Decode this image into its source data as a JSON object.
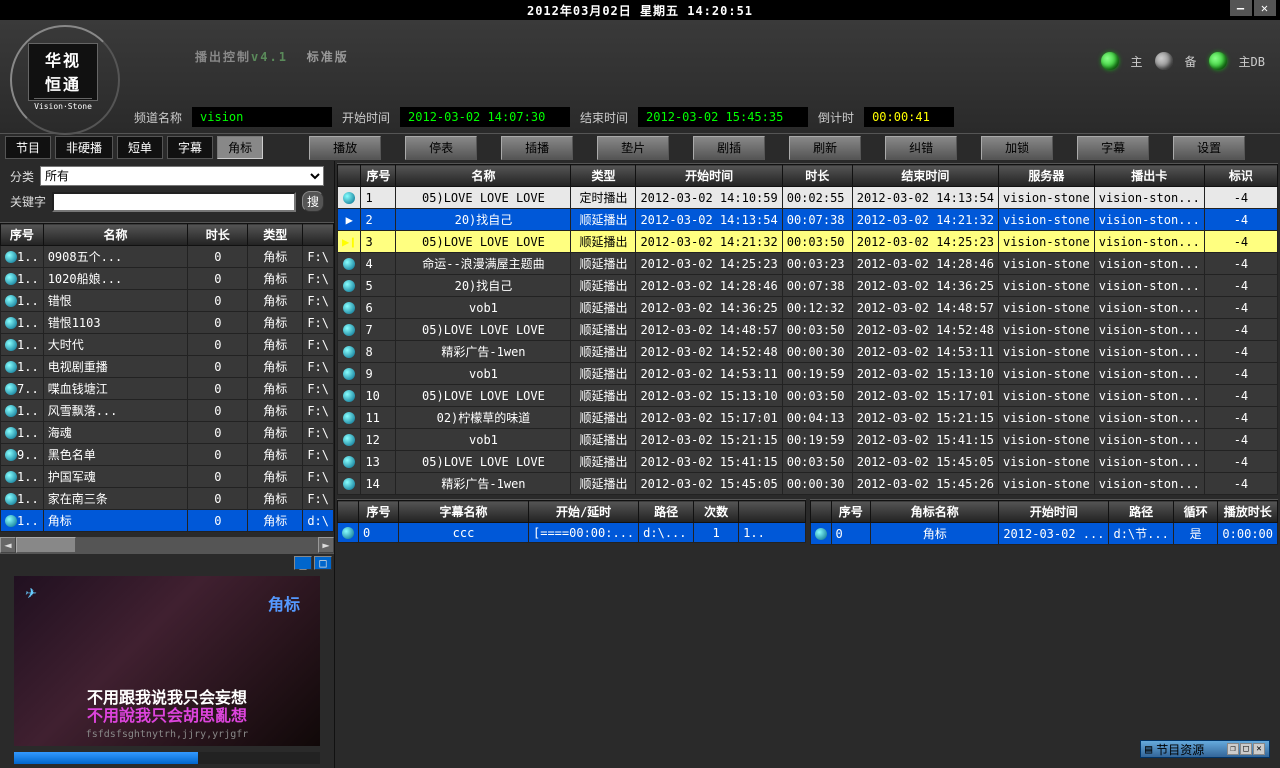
{
  "top": {
    "datetime": "2012年03月02日  星期五    14:20:51"
  },
  "logo": {
    "cn": "华视\n恒通",
    "en": "Vision·Stone"
  },
  "title": {
    "main": "播出控制",
    "ver": "v4.1",
    "std": "标准版"
  },
  "leds": {
    "l1": "主",
    "l2": "备",
    "l3": "主DB"
  },
  "info": {
    "ch_lbl": "频道名称",
    "ch_val": "vision",
    "st_lbl": "开始时间",
    "st_val": "2012-03-02 14:07:30",
    "et_lbl": "结束时间",
    "et_val": "2012-03-02 15:45:35",
    "cd_lbl": "倒计时",
    "cd_val": "00:00:41"
  },
  "tabs": {
    "t1": "节目",
    "t2": "非硬播",
    "t3": "短单",
    "t4": "字幕",
    "t5": "角标"
  },
  "btns": {
    "b1": "播放",
    "b2": "停表",
    "b3": "插播",
    "b4": "垫片",
    "b5": "剧插",
    "b6": "刷新",
    "b7": "纠错",
    "b8": "加锁",
    "b9": "字幕",
    "b10": "设置"
  },
  "filter": {
    "cat_lbl": "分类",
    "cat_val": "所有",
    "kw_lbl": "关键字",
    "srch": "搜"
  },
  "side_cols": {
    "c1": "序号",
    "c2": "名称",
    "c3": "时长",
    "c4": "类型",
    "c5": ""
  },
  "side_rows": [
    {
      "n": "1..",
      "name": "0908五个...",
      "dur": "0",
      "type": "角标",
      "p": "F:\\"
    },
    {
      "n": "1..",
      "name": "1020船娘...",
      "dur": "0",
      "type": "角标",
      "p": "F:\\"
    },
    {
      "n": "1..",
      "name": "错恨",
      "dur": "0",
      "type": "角标",
      "p": "F:\\"
    },
    {
      "n": "1..",
      "name": "错恨1103",
      "dur": "0",
      "type": "角标",
      "p": "F:\\"
    },
    {
      "n": "1..",
      "name": "大时代",
      "dur": "0",
      "type": "角标",
      "p": "F:\\"
    },
    {
      "n": "1..",
      "name": "电视剧重播",
      "dur": "0",
      "type": "角标",
      "p": "F:\\"
    },
    {
      "n": "7..",
      "name": "喋血钱塘江",
      "dur": "0",
      "type": "角标",
      "p": "F:\\"
    },
    {
      "n": "1..",
      "name": "风雪飘落...",
      "dur": "0",
      "type": "角标",
      "p": "F:\\"
    },
    {
      "n": "1..",
      "name": "海魂",
      "dur": "0",
      "type": "角标",
      "p": "F:\\"
    },
    {
      "n": "9..",
      "name": "黑色名单",
      "dur": "0",
      "type": "角标",
      "p": "F:\\"
    },
    {
      "n": "1..",
      "name": "护国军魂",
      "dur": "0",
      "type": "角标",
      "p": "F:\\"
    },
    {
      "n": "1..",
      "name": "家在南三条",
      "dur": "0",
      "type": "角标",
      "p": "F:\\"
    },
    {
      "n": "1..",
      "name": "角标",
      "dur": "0",
      "type": "角标",
      "p": "d:\\",
      "sel": true
    }
  ],
  "preview": {
    "corner": "角标",
    "sub1": "不用跟我说我只会妄想",
    "sub2": "不用說我只会胡思亂想",
    "sub3": "fsfdsfsghtnytrh,jjry,yrjgfr"
  },
  "pl_cols": {
    "c1": "序号",
    "c2": "名称",
    "c3": "类型",
    "c4": "开始时间",
    "c5": "时长",
    "c6": "结束时间",
    "c7": "服务器",
    "c8": "播出卡",
    "c9": "标识"
  },
  "pl_rows": [
    {
      "n": "1",
      "name": "05)LOVE LOVE LOVE",
      "type": "定时播出",
      "st": "2012-03-02 14:10:59",
      "dur": "00:02:55",
      "et": "2012-03-02 14:13:54",
      "srv": "vision-stone",
      "card": "vision-ston...",
      "flag": "-4",
      "kind": "wh"
    },
    {
      "n": "2",
      "name": "20)找自己",
      "type": "顺延播出",
      "st": "2012-03-02 14:13:54",
      "dur": "00:07:38",
      "et": "2012-03-02 14:21:32",
      "srv": "vision-stone",
      "card": "vision-ston...",
      "flag": "-4",
      "kind": "sel"
    },
    {
      "n": "3",
      "name": "05)LOVE LOVE LOVE",
      "type": "顺延播出",
      "st": "2012-03-02 14:21:32",
      "dur": "00:03:50",
      "et": "2012-03-02 14:25:23",
      "srv": "vision-stone",
      "card": "vision-ston...",
      "flag": "-4",
      "kind": "hl"
    },
    {
      "n": "4",
      "name": "命运--浪漫满屋主题曲",
      "type": "顺延播出",
      "st": "2012-03-02 14:25:23",
      "dur": "00:03:23",
      "et": "2012-03-02 14:28:46",
      "srv": "vision-stone",
      "card": "vision-ston...",
      "flag": "-4"
    },
    {
      "n": "5",
      "name": "20)找自己",
      "type": "顺延播出",
      "st": "2012-03-02 14:28:46",
      "dur": "00:07:38",
      "et": "2012-03-02 14:36:25",
      "srv": "vision-stone",
      "card": "vision-ston...",
      "flag": "-4"
    },
    {
      "n": "6",
      "name": "vob1",
      "type": "顺延播出",
      "st": "2012-03-02 14:36:25",
      "dur": "00:12:32",
      "et": "2012-03-02 14:48:57",
      "srv": "vision-stone",
      "card": "vision-ston...",
      "flag": "-4"
    },
    {
      "n": "7",
      "name": "05)LOVE LOVE LOVE",
      "type": "顺延播出",
      "st": "2012-03-02 14:48:57",
      "dur": "00:03:50",
      "et": "2012-03-02 14:52:48",
      "srv": "vision-stone",
      "card": "vision-ston...",
      "flag": "-4"
    },
    {
      "n": "8",
      "name": "精彩广告-1wen",
      "type": "顺延播出",
      "st": "2012-03-02 14:52:48",
      "dur": "00:00:30",
      "et": "2012-03-02 14:53:11",
      "srv": "vision-stone",
      "card": "vision-ston...",
      "flag": "-4"
    },
    {
      "n": "9",
      "name": "vob1",
      "type": "顺延播出",
      "st": "2012-03-02 14:53:11",
      "dur": "00:19:59",
      "et": "2012-03-02 15:13:10",
      "srv": "vision-stone",
      "card": "vision-ston...",
      "flag": "-4"
    },
    {
      "n": "10",
      "name": "05)LOVE LOVE LOVE",
      "type": "顺延播出",
      "st": "2012-03-02 15:13:10",
      "dur": "00:03:50",
      "et": "2012-03-02 15:17:01",
      "srv": "vision-stone",
      "card": "vision-ston...",
      "flag": "-4"
    },
    {
      "n": "11",
      "name": "02)柠檬草的味道",
      "type": "顺延播出",
      "st": "2012-03-02 15:17:01",
      "dur": "00:04:13",
      "et": "2012-03-02 15:21:15",
      "srv": "vision-stone",
      "card": "vision-ston...",
      "flag": "-4"
    },
    {
      "n": "12",
      "name": "vob1",
      "type": "顺延播出",
      "st": "2012-03-02 15:21:15",
      "dur": "00:19:59",
      "et": "2012-03-02 15:41:15",
      "srv": "vision-stone",
      "card": "vision-ston...",
      "flag": "-4"
    },
    {
      "n": "13",
      "name": "05)LOVE LOVE LOVE",
      "type": "顺延播出",
      "st": "2012-03-02 15:41:15",
      "dur": "00:03:50",
      "et": "2012-03-02 15:45:05",
      "srv": "vision-stone",
      "card": "vision-ston...",
      "flag": "-4"
    },
    {
      "n": "14",
      "name": "精彩广告-1wen",
      "type": "顺延播出",
      "st": "2012-03-02 15:45:05",
      "dur": "00:00:30",
      "et": "2012-03-02 15:45:26",
      "srv": "vision-stone",
      "card": "vision-ston...",
      "flag": "-4"
    }
  ],
  "sub_cols": {
    "c1": "序号",
    "c2": "字幕名称",
    "c3": "开始/延时",
    "c4": "路径",
    "c5": "次数"
  },
  "sub_rows": [
    {
      "n": "0",
      "name": "ccc",
      "st": "[====00:00:...",
      "path": "d:\\...",
      "cnt": "1",
      "p2": "1.."
    }
  ],
  "corner_cols": {
    "c1": "序号",
    "c2": "角标名称",
    "c3": "开始时间",
    "c4": "路径",
    "c5": "循环",
    "c6": "播放时长"
  },
  "corner_rows": [
    {
      "n": "0",
      "name": "角标",
      "st": "2012-03-02 ...",
      "path": "d:\\节...",
      "loop": "是",
      "dur": "0:00:00"
    }
  ],
  "mini": {
    "title": "节目资源"
  }
}
